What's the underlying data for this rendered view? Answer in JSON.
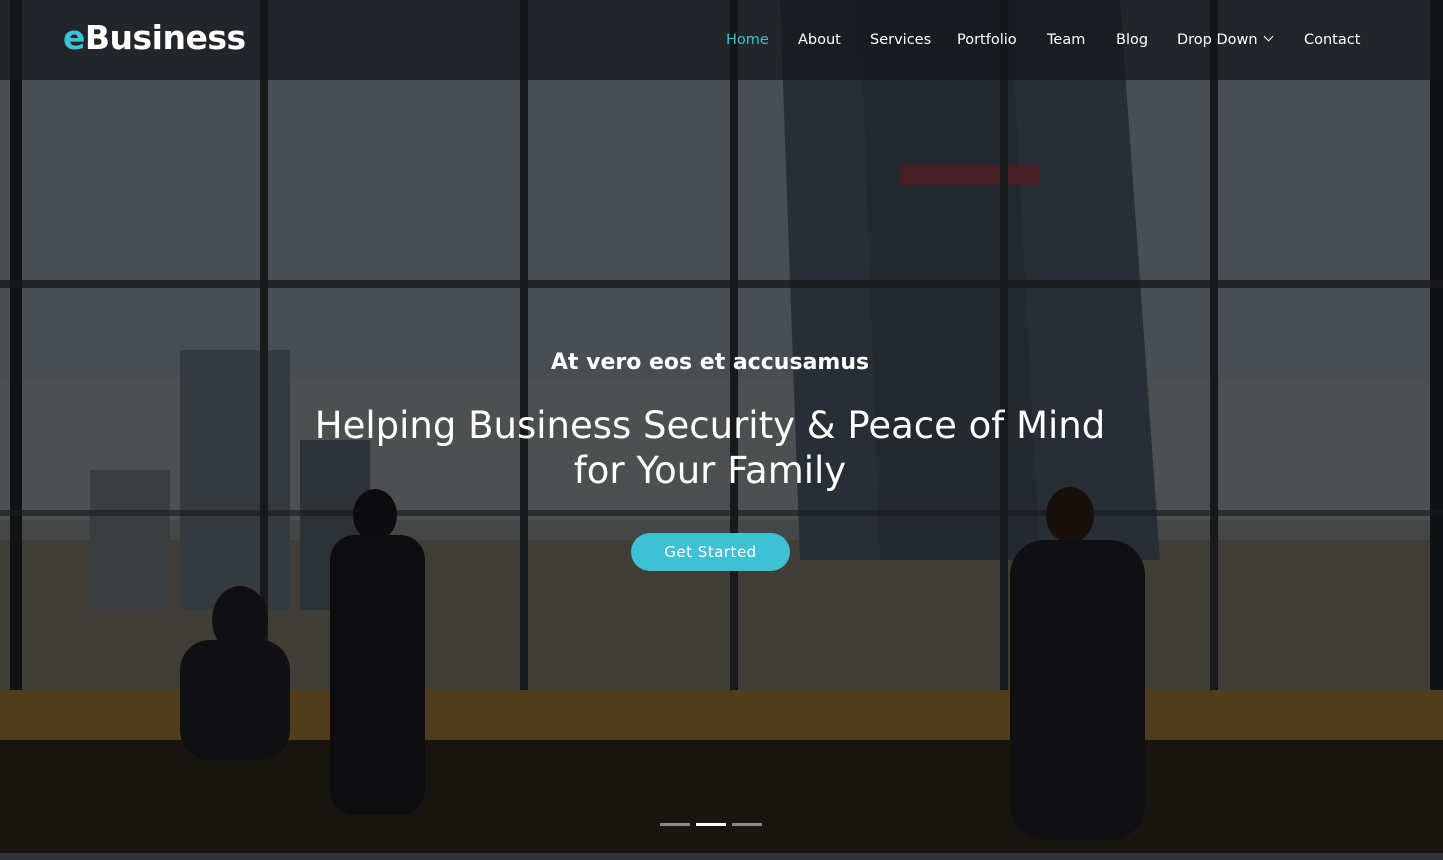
{
  "brand": {
    "logo_accent": "e",
    "logo_rest": "Business",
    "accent_color": "#3ec1d5"
  },
  "nav": {
    "items": [
      {
        "label": "Home",
        "active": true
      },
      {
        "label": "About"
      },
      {
        "label": "Services"
      },
      {
        "label": "Portfolio"
      },
      {
        "label": "Team"
      },
      {
        "label": "Blog"
      },
      {
        "label": "Drop Down",
        "icon": "chevron-down-icon"
      },
      {
        "label": "Contact"
      }
    ]
  },
  "hero": {
    "subtitle": "At vero eos et accusamus",
    "headline": "Helping Business Security & Peace of Mind for Your Family",
    "cta_label": "Get Started",
    "slide_count": 3,
    "active_slide": 2
  }
}
